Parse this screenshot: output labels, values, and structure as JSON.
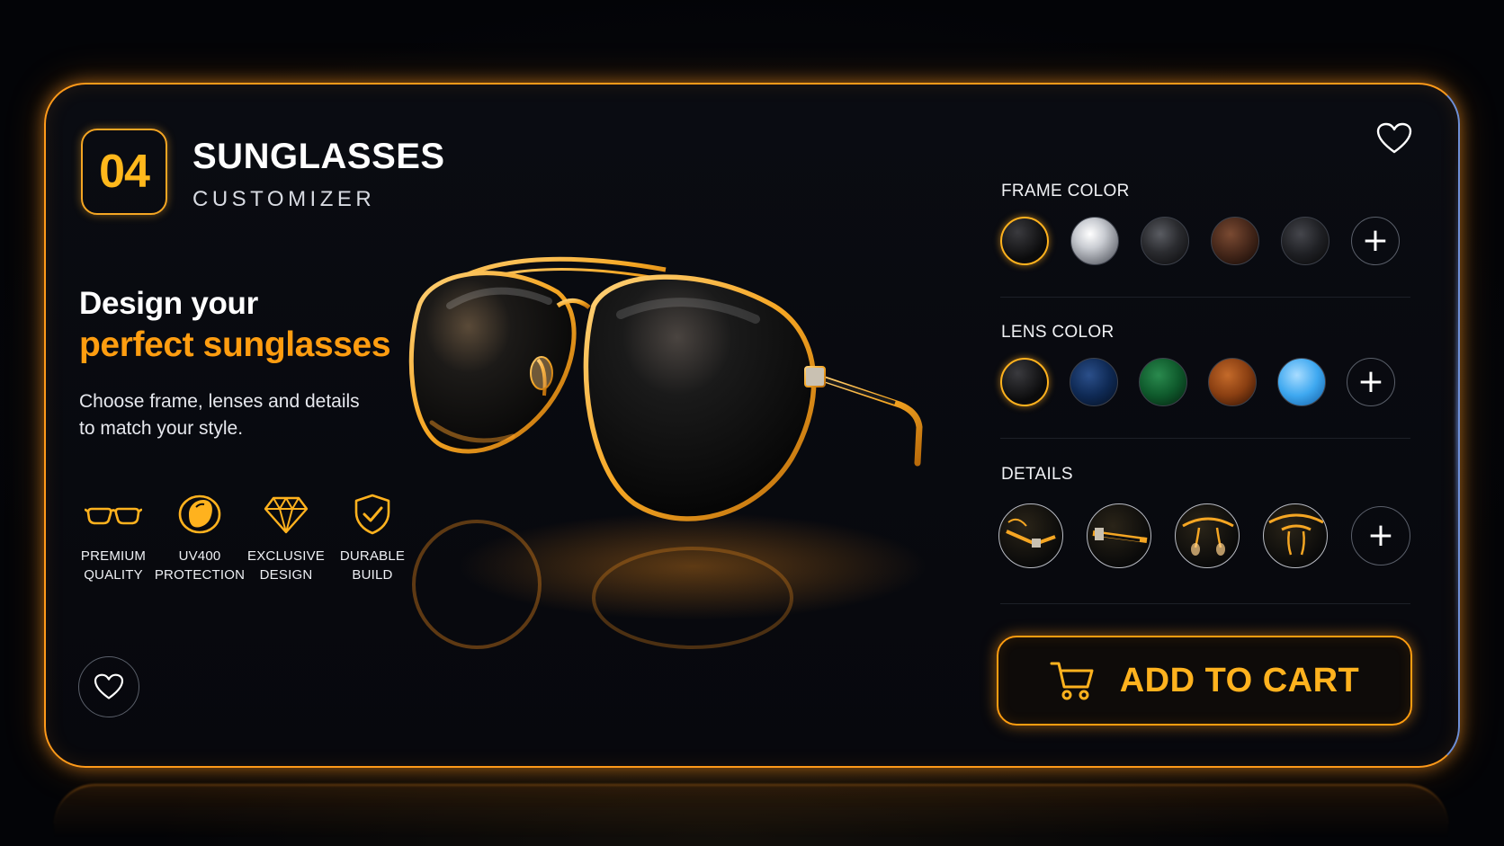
{
  "header": {
    "step_number": "04",
    "title": "SUNGLASSES",
    "subtitle": "CUSTOMIZER"
  },
  "hero": {
    "line1": "Design your",
    "line2": "perfect sunglasses",
    "description": "Choose frame, lenses and details to match your style."
  },
  "features": [
    {
      "icon": "glasses-icon",
      "label": "PREMIUM\nQUALITY"
    },
    {
      "icon": "lens-icon",
      "label": "UV400\nPROTECTION"
    },
    {
      "icon": "diamond-icon",
      "label": "EXCLUSIVE\nDESIGN"
    },
    {
      "icon": "shield-check-icon",
      "label": "DURABLE\nBUILD"
    }
  ],
  "frame_color": {
    "label": "FRAME COLOR",
    "options": [
      {
        "name": "black-gold",
        "color": "#0b0b0c",
        "selected": true
      },
      {
        "name": "silver",
        "color": "#c9ccd2",
        "selected": false
      },
      {
        "name": "gunmetal",
        "color": "#2b2c30",
        "selected": false
      },
      {
        "name": "brown",
        "color": "#4a2a1c",
        "selected": false
      },
      {
        "name": "dark-grey",
        "color": "#1f2024",
        "selected": false
      }
    ]
  },
  "lens_color": {
    "label": "LENS COLOR",
    "options": [
      {
        "name": "black",
        "color": "#0b0b0c",
        "selected": true
      },
      {
        "name": "navy",
        "color": "#0f2a55",
        "selected": false
      },
      {
        "name": "green",
        "color": "#0f5a2c",
        "selected": false
      },
      {
        "name": "amber",
        "color": "#8a3f12",
        "selected": false
      },
      {
        "name": "sky-blue",
        "color": "#3ea8f0",
        "selected": false
      }
    ]
  },
  "details": {
    "label": "DETAILS"
  },
  "cart": {
    "label": "ADD TO CART"
  },
  "colors": {
    "accent": "#ff9d10",
    "accent_light": "#ffb21e",
    "edge_blue": "#6e8fd6"
  }
}
